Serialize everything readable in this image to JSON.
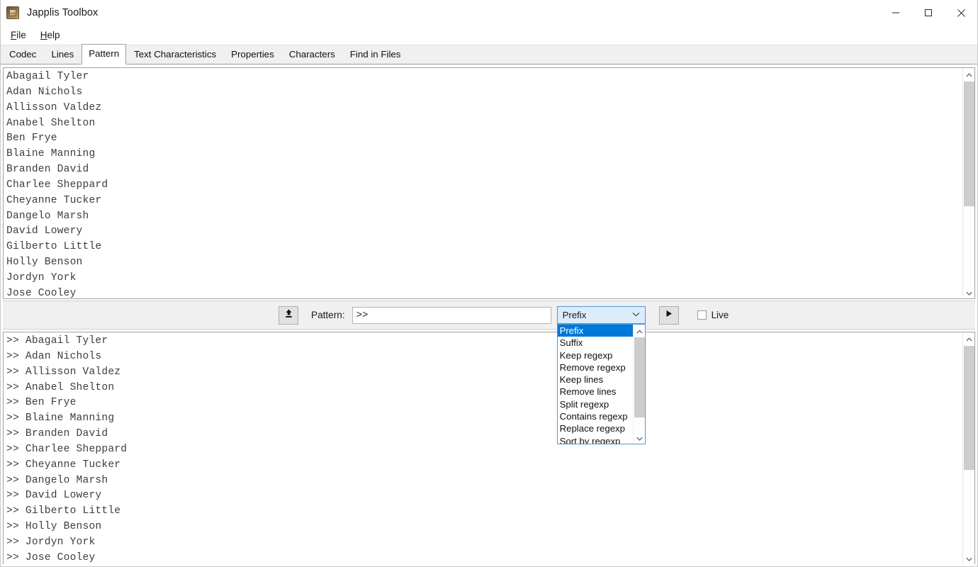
{
  "window": {
    "title": "Japplis Toolbox",
    "icon": "toolbox-icon",
    "controls": {
      "minimize": "minimize-icon",
      "maximize": "maximize-icon",
      "close": "close-icon"
    }
  },
  "menubar": {
    "items": [
      {
        "label": "File",
        "mnemonic": "F"
      },
      {
        "label": "Help",
        "mnemonic": "H"
      }
    ]
  },
  "tabs": [
    {
      "label": "Codec",
      "active": false
    },
    {
      "label": "Lines",
      "active": false
    },
    {
      "label": "Pattern",
      "active": true
    },
    {
      "label": "Text Characteristics",
      "active": false
    },
    {
      "label": "Properties",
      "active": false
    },
    {
      "label": "Characters",
      "active": false
    },
    {
      "label": "Find in Files",
      "active": false
    }
  ],
  "input_panel": {
    "text": "Abagail Tyler\nAdan Nichols\nAllisson Valdez\nAnabel Shelton\nBen Frye\nBlaine Manning\nBranden David\nCharlee Sheppard\nCheyanne Tucker\nDangelo Marsh\nDavid Lowery\nGilberto Little\nHolly Benson\nJordyn York\nJose Cooley",
    "lines": [
      "Abagail Tyler",
      "Adan Nichols",
      "Allisson Valdez",
      "Anabel Shelton",
      "Ben Frye",
      "Blaine Manning",
      "Branden David",
      "Charlee Sheppard",
      "Cheyanne Tucker",
      "Dangelo Marsh",
      "David Lowery",
      "Gilberto Little",
      "Holly Benson",
      "Jordyn York",
      "Jose Cooley"
    ]
  },
  "output_panel": {
    "text": ">> Abagail Tyler\n>> Adan Nichols\n>> Allisson Valdez\n>> Anabel Shelton\n>> Ben Frye\n>> Blaine Manning\n>> Branden David\n>> Charlee Sheppard\n>> Cheyanne Tucker\n>> Dangelo Marsh\n>> David Lowery\n>> Gilberto Little\n>> Holly Benson\n>> Jordyn York\n>> Jose Cooley",
    "lines": [
      ">> Abagail Tyler",
      ">> Adan Nichols",
      ">> Allisson Valdez",
      ">> Anabel Shelton",
      ">> Ben Frye",
      ">> Blaine Manning",
      ">> Branden David",
      ">> Charlee Sheppard",
      ">> Cheyanne Tucker",
      ">> Dangelo Marsh",
      ">> David Lowery",
      ">> Gilberto Little",
      ">> Holly Benson",
      ">> Jordyn York",
      ">> Jose Cooley"
    ]
  },
  "toolbar": {
    "load_icon": "upload-icon",
    "pattern_label": "Pattern:",
    "pattern_value": ">>",
    "pattern_placeholder": "",
    "run_icon": "play-icon",
    "live_label": "Live",
    "live_checked": false
  },
  "mode_combo": {
    "selected": "Prefix",
    "expanded": true,
    "chevron": "chevron-down-icon",
    "options": [
      "Prefix",
      "Suffix",
      "Keep regexp",
      "Remove regexp",
      "Keep lines",
      "Remove lines",
      "Split regexp",
      "Contains regexp",
      "Replace regexp",
      "Sort by regexp"
    ]
  },
  "colors": {
    "accent": "#0078d7",
    "combo_border": "#4a9ada",
    "combo_bg": "#dcecfb",
    "toolbar_bg": "#f0f0f0",
    "text": "#3d3d3d",
    "panel_border": "#a0a0a0"
  }
}
